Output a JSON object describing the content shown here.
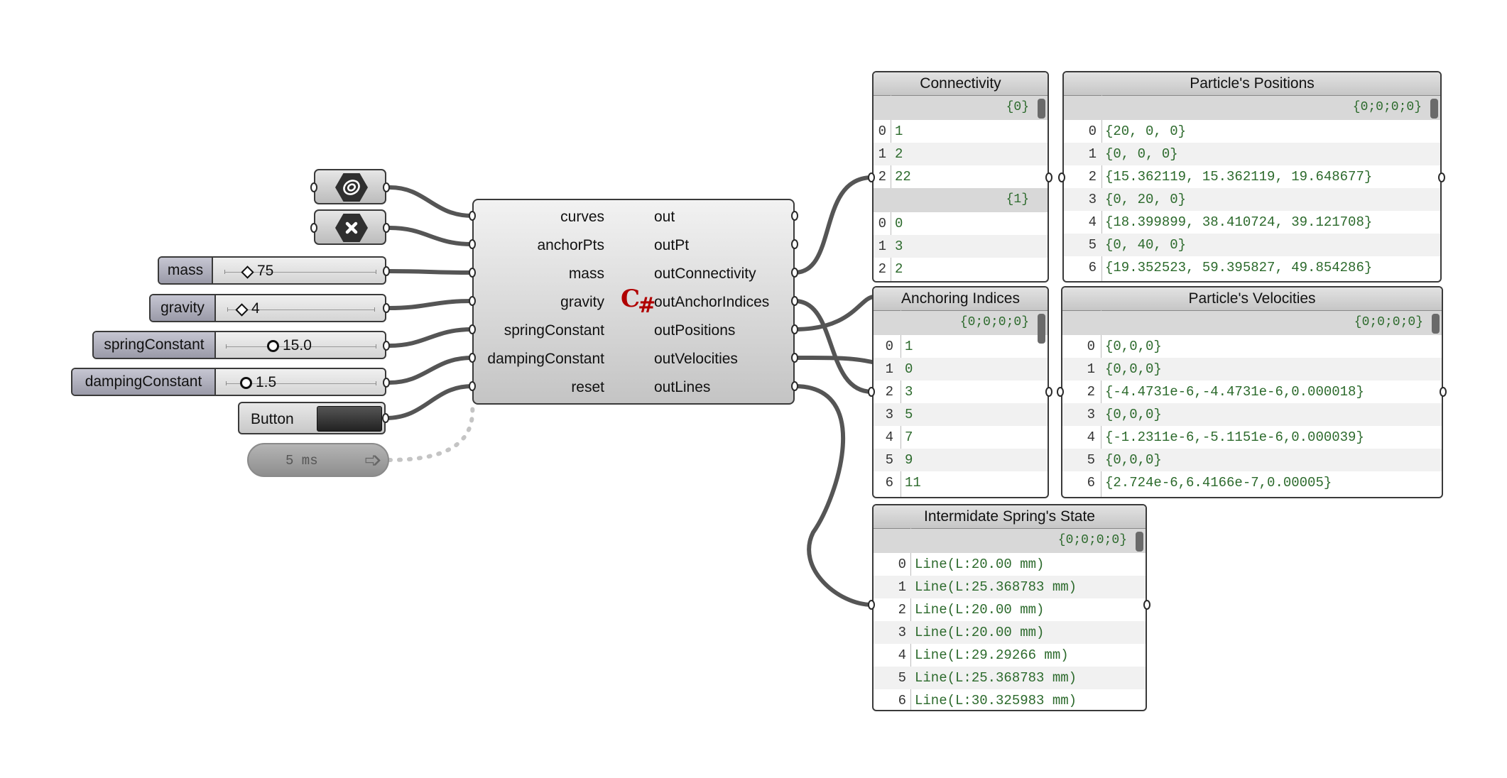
{
  "params": {
    "curve_icon": "curve-param-icon",
    "point_icon": "point-param-icon"
  },
  "sliders": [
    {
      "name": "mass",
      "value": "75",
      "knob": "diamond"
    },
    {
      "name": "gravity",
      "value": "4",
      "knob": "diamond"
    },
    {
      "name": "springConstant",
      "value": "15.0",
      "knob": "circle"
    },
    {
      "name": "dampingConstant",
      "value": "1.5",
      "knob": "circle"
    }
  ],
  "button": {
    "label": "Button"
  },
  "timer": {
    "label": "5 ms"
  },
  "component": {
    "icon": "C#",
    "inputs": [
      "curves",
      "anchorPts",
      "mass",
      "gravity",
      "springConstant",
      "dampingConstant",
      "reset"
    ],
    "outputs": [
      "out",
      "outPt",
      "outConnectivity",
      "outAnchorIndices",
      "outPositions",
      "outVelocities",
      "outLines"
    ]
  },
  "panels": {
    "connectivity": {
      "title": "Connectivity",
      "branches": [
        {
          "path": "{0}",
          "rows": [
            [
              "0",
              "1"
            ],
            [
              "1",
              "2"
            ],
            [
              "2",
              "22"
            ]
          ]
        },
        {
          "path": "{1}",
          "rows": [
            [
              "0",
              "0"
            ],
            [
              "1",
              "3"
            ],
            [
              "2",
              "2"
            ]
          ]
        }
      ]
    },
    "positions": {
      "title": "Particle's Positions",
      "path": "{0;0;0;0}",
      "rows": [
        [
          "0",
          "{20, 0, 0}"
        ],
        [
          "1",
          "{0, 0, 0}"
        ],
        [
          "2",
          "{15.362119, 15.362119, 19.648677}"
        ],
        [
          "3",
          "{0, 20, 0}"
        ],
        [
          "4",
          "{18.399899, 38.410724, 39.121708}"
        ],
        [
          "5",
          "{0, 40, 0}"
        ],
        [
          "6",
          "{19.352523, 59.395827, 49.854286}"
        ]
      ]
    },
    "anchoring": {
      "title": "Anchoring Indices",
      "path": "{0;0;0;0}",
      "rows": [
        [
          "0",
          "1"
        ],
        [
          "1",
          "0"
        ],
        [
          "2",
          "3"
        ],
        [
          "3",
          "5"
        ],
        [
          "4",
          "7"
        ],
        [
          "5",
          "9"
        ],
        [
          "6",
          "11"
        ]
      ]
    },
    "velocities": {
      "title": "Particle's Velocities",
      "path": "{0;0;0;0}",
      "rows": [
        [
          "0",
          "{0,0,0}"
        ],
        [
          "1",
          "{0,0,0}"
        ],
        [
          "2",
          "{-4.4731e-6,-4.4731e-6,0.000018}"
        ],
        [
          "3",
          "{0,0,0}"
        ],
        [
          "4",
          "{-1.2311e-6,-5.1151e-6,0.000039}"
        ],
        [
          "5",
          "{0,0,0}"
        ],
        [
          "6",
          "{2.724e-6,6.4166e-7,0.00005}"
        ]
      ]
    },
    "springs": {
      "title": "Intermidate Spring's State",
      "path": "{0;0;0;0}",
      "rows": [
        [
          "0",
          "Line(L:20.00 mm)"
        ],
        [
          "1",
          "Line(L:25.368783 mm)"
        ],
        [
          "2",
          "Line(L:20.00 mm)"
        ],
        [
          "3",
          "Line(L:20.00 mm)"
        ],
        [
          "4",
          "Line(L:29.29266 mm)"
        ],
        [
          "5",
          "Line(L:25.368783 mm)"
        ],
        [
          "6",
          "Line(L:30.325983 mm)"
        ]
      ]
    }
  }
}
